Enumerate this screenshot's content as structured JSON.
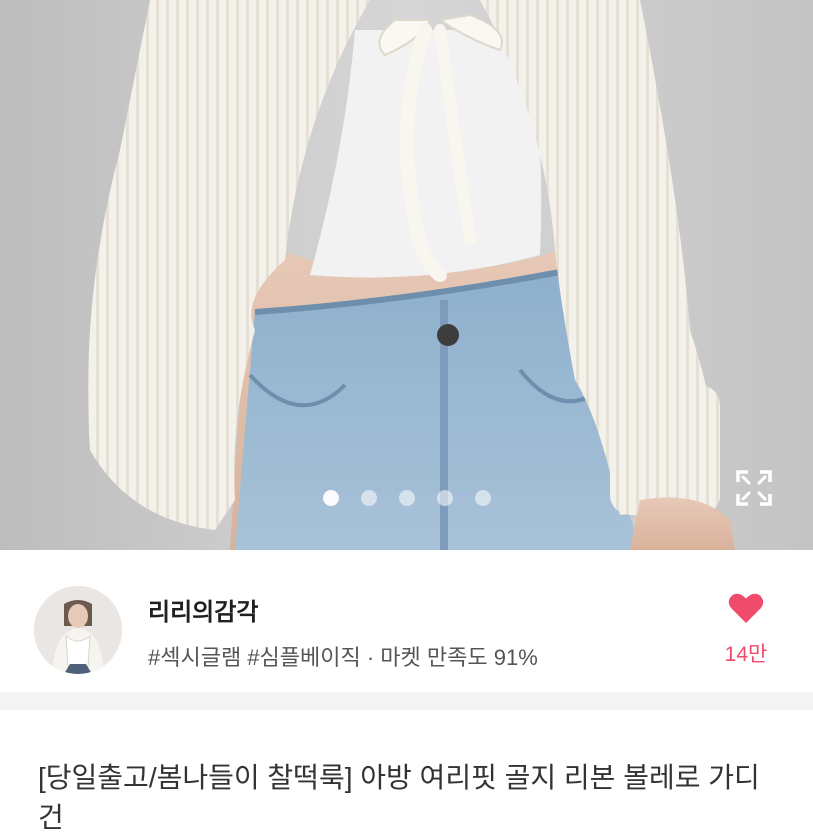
{
  "product": {
    "image_alt": "white ribbon bolero cardigan with jeans",
    "carousel": {
      "total": 5,
      "active": 1
    }
  },
  "seller": {
    "name": "리리의감각",
    "tags": "#섹시글램 #심플베이직 · 마켓 만족도 91%"
  },
  "like": {
    "count": "14만",
    "color": "#ef4b6a",
    "icon": "heart-icon"
  },
  "item": {
    "title": "[당일출고/봄나들이 찰떡룩] 아방 여리핏 골지 리본 볼레로 가디건"
  },
  "icons": {
    "expand": "expand-icon"
  }
}
